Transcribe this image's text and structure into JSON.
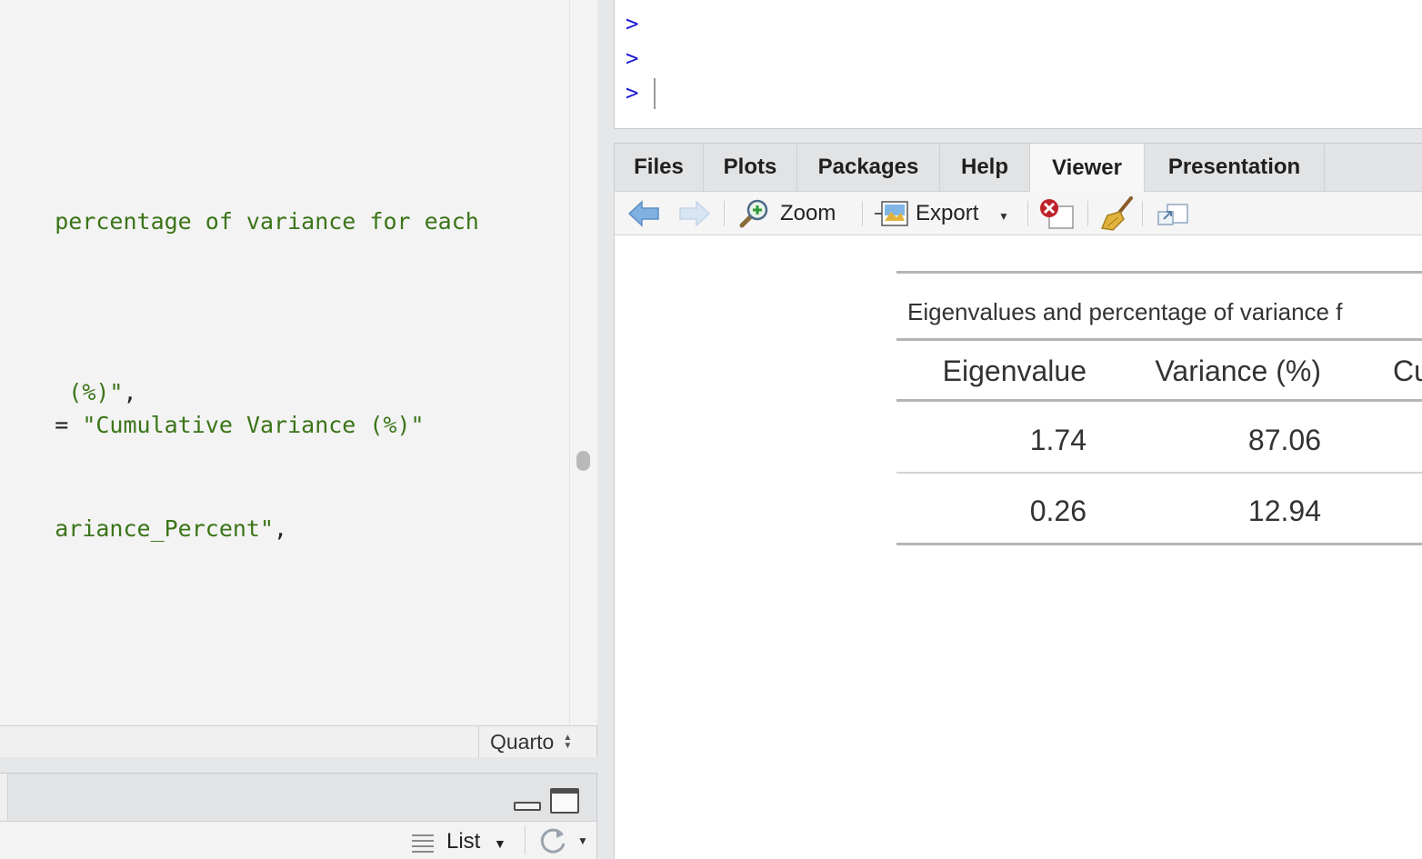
{
  "editor": {
    "code_lines": [
      {
        "text": "percentage of variance for each"
      },
      {
        "text": " (%)\"",
        "trail": ","
      },
      {
        "lead": "= ",
        "text": "\"Cumulative Variance (%)\""
      },
      {
        "text": "ariance_Percent\"",
        "trail": ","
      }
    ],
    "language": "Quarto"
  },
  "env_pane": {
    "view_mode": "List"
  },
  "console": {
    "prompt": ">"
  },
  "viewer_pane": {
    "tabs": [
      {
        "label": "Files",
        "active": false
      },
      {
        "label": "Plots",
        "active": false
      },
      {
        "label": "Packages",
        "active": false
      },
      {
        "label": "Help",
        "active": false
      },
      {
        "label": "Viewer",
        "active": true
      },
      {
        "label": "Presentation",
        "active": false
      }
    ],
    "toolbar": {
      "zoom_label": "Zoom",
      "export_label": "Export"
    },
    "table": {
      "title": "Eigenvalues and percentage of variance f",
      "columns": [
        "Eigenvalue",
        "Variance (%)",
        "Cu"
      ],
      "rows": [
        [
          "1.74",
          "87.06"
        ],
        [
          "0.26",
          "12.94"
        ]
      ]
    }
  },
  "colors": {
    "code_string": "#3a7417",
    "console_prompt": "#1717d8"
  }
}
